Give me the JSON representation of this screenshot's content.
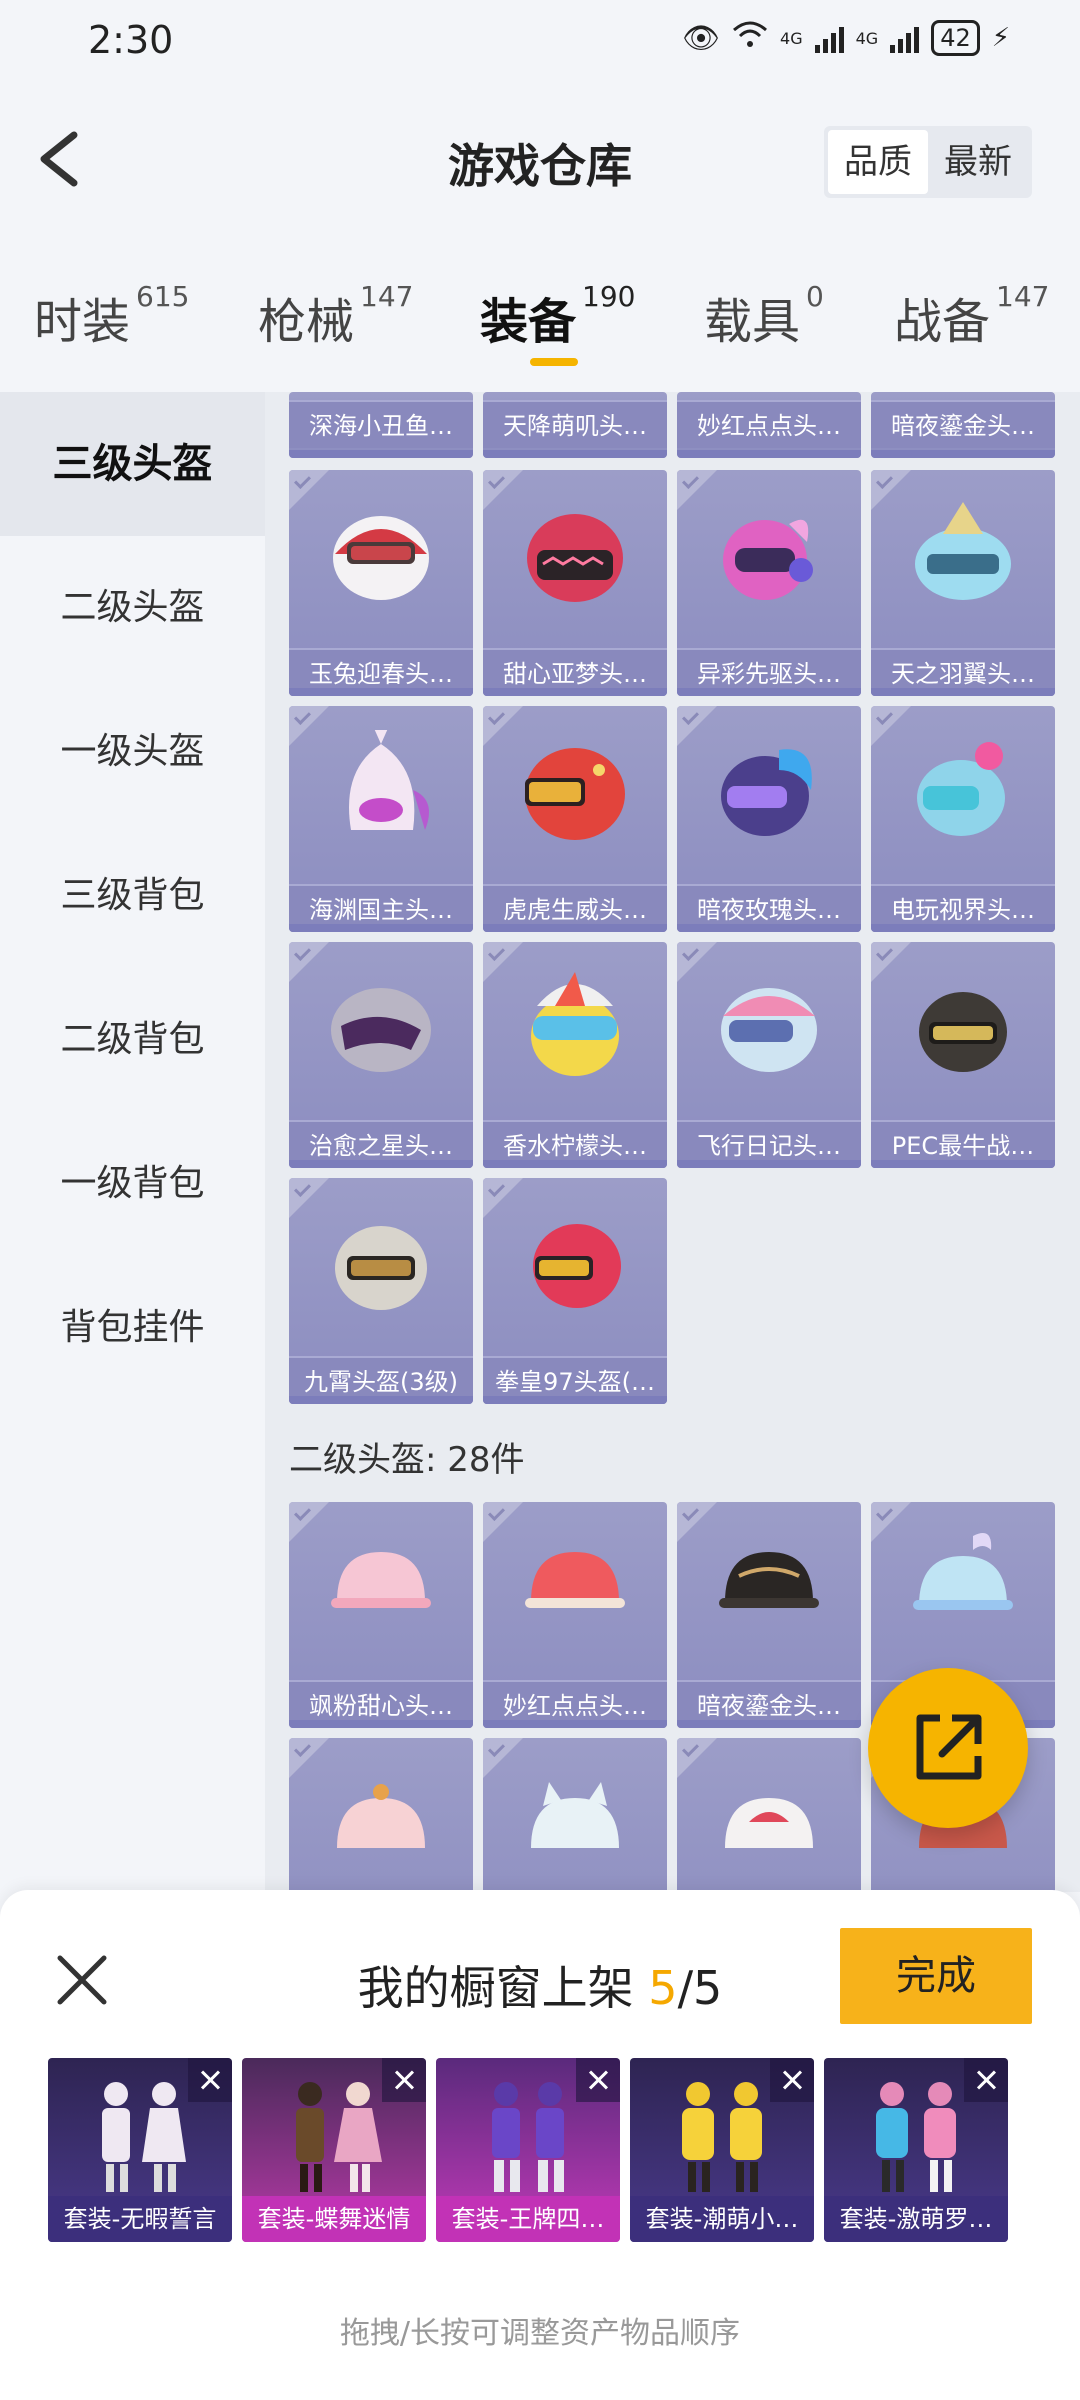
{
  "status_bar": {
    "time": "2:30",
    "network_1": "4G",
    "network_2": "4G",
    "battery": "42"
  },
  "header": {
    "title": "游戏仓库",
    "sort_options": [
      "品质",
      "最新"
    ],
    "sort_active": "品质"
  },
  "tabs": [
    {
      "label": "时装",
      "count": "615"
    },
    {
      "label": "枪械",
      "count": "147"
    },
    {
      "label": "装备",
      "count": "190"
    },
    {
      "label": "载具",
      "count": "0"
    },
    {
      "label": "战备",
      "count": "147"
    }
  ],
  "sidebar": {
    "items": [
      "三级头盔",
      "二级头盔",
      "一级头盔",
      "三级背包",
      "二级背包",
      "一级背包",
      "背包挂件"
    ]
  },
  "grid": {
    "partial_row": [
      "深海小丑鱼…",
      "天降萌叽头…",
      "妙红点点头…",
      "暗夜鎏金头…"
    ],
    "level3": [
      "玉兔迎春头…",
      "甜心亚梦头…",
      "异彩先驱头…",
      "天之羽翼头…",
      "海渊国主头…",
      "虎虎生威头…",
      "暗夜玫瑰头…",
      "电玩视界头…",
      "治愈之星头…",
      "香水柠檬头…",
      "飞行日记头…",
      "PEC最牛战…",
      "九霄头盔(3级)",
      "拳皇97头盔(…"
    ],
    "section_title": "二级头盔: 28件",
    "level2": [
      "飒粉甜心头…",
      "妙红点点头…",
      "暗夜鎏金头…",
      ""
    ]
  },
  "panel": {
    "title_prefix": "我的橱窗上架 ",
    "count_current": "5",
    "count_total": "/5",
    "done_label": "完成",
    "items": [
      "套装-无暇誓言",
      "套装-蝶舞迷情",
      "套装-王牌四…",
      "套装-潮萌小…",
      "套装-激萌罗…"
    ],
    "hint": "拖拽/长按可调整资产物品顺序"
  },
  "colors": {
    "accent": "#f5b400",
    "card_bg": "#9293c4",
    "card_label": "#8989bd",
    "show_purple": "#3b2a78",
    "show_magenta": "#c232b6"
  }
}
